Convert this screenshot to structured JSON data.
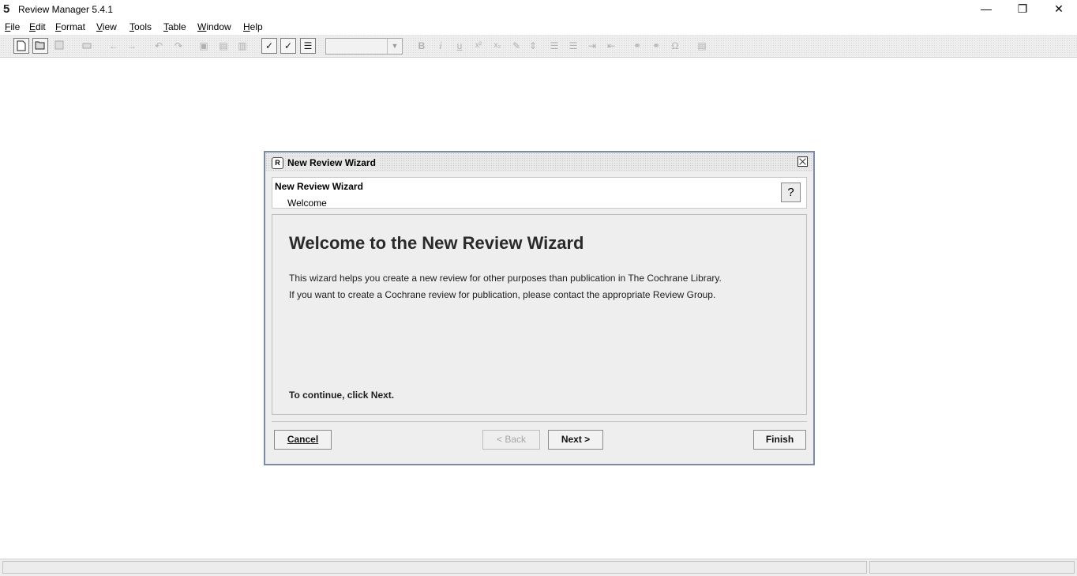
{
  "window": {
    "title": "Review Manager 5.4.1",
    "logo": "5"
  },
  "menu": [
    "File",
    "Edit",
    "Format",
    "View",
    "Tools",
    "Table",
    "Window",
    "Help"
  ],
  "toolbar": {
    "font_box_value": "",
    "bold": "B",
    "italic": "i",
    "underline": "u",
    "superscript": "x²",
    "subscript": "x₂",
    "omega": "Ω"
  },
  "dialog": {
    "title": "New Review Wizard",
    "icon_letter": "R",
    "header_title": "New Review Wizard",
    "header_subtitle": "Welcome",
    "help_symbol": "?",
    "heading": "Welcome to the New Review Wizard",
    "lines": [
      "This wizard helps you create a new review for other purposes than publication in The Cochrane Library.",
      "If you want to create a Cochrane review for publication, please contact the appropriate Review Group."
    ],
    "continue_text": "To continue, click Next.",
    "buttons": {
      "cancel": "Cancel",
      "back": "< Back",
      "next": "Next >",
      "finish": "Finish"
    }
  }
}
